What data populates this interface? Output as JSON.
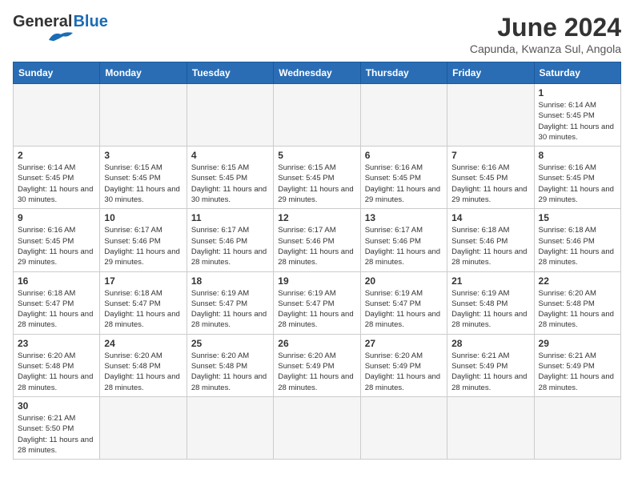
{
  "header": {
    "logo_general": "General",
    "logo_blue": "Blue",
    "title": "June 2024",
    "subtitle": "Capunda, Kwanza Sul, Angola"
  },
  "days_of_week": [
    "Sunday",
    "Monday",
    "Tuesday",
    "Wednesday",
    "Thursday",
    "Friday",
    "Saturday"
  ],
  "weeks": [
    [
      {
        "day": "",
        "sunrise": "",
        "sunset": "",
        "daylight": "",
        "empty": true
      },
      {
        "day": "",
        "sunrise": "",
        "sunset": "",
        "daylight": "",
        "empty": true
      },
      {
        "day": "",
        "sunrise": "",
        "sunset": "",
        "daylight": "",
        "empty": true
      },
      {
        "day": "",
        "sunrise": "",
        "sunset": "",
        "daylight": "",
        "empty": true
      },
      {
        "day": "",
        "sunrise": "",
        "sunset": "",
        "daylight": "",
        "empty": true
      },
      {
        "day": "",
        "sunrise": "",
        "sunset": "",
        "daylight": "",
        "empty": true
      },
      {
        "day": "1",
        "sunrise": "Sunrise: 6:14 AM",
        "sunset": "Sunset: 5:45 PM",
        "daylight": "Daylight: 11 hours and 30 minutes.",
        "empty": false
      }
    ],
    [
      {
        "day": "2",
        "sunrise": "Sunrise: 6:14 AM",
        "sunset": "Sunset: 5:45 PM",
        "daylight": "Daylight: 11 hours and 30 minutes.",
        "empty": false
      },
      {
        "day": "3",
        "sunrise": "Sunrise: 6:15 AM",
        "sunset": "Sunset: 5:45 PM",
        "daylight": "Daylight: 11 hours and 30 minutes.",
        "empty": false
      },
      {
        "day": "4",
        "sunrise": "Sunrise: 6:15 AM",
        "sunset": "Sunset: 5:45 PM",
        "daylight": "Daylight: 11 hours and 30 minutes.",
        "empty": false
      },
      {
        "day": "5",
        "sunrise": "Sunrise: 6:15 AM",
        "sunset": "Sunset: 5:45 PM",
        "daylight": "Daylight: 11 hours and 29 minutes.",
        "empty": false
      },
      {
        "day": "6",
        "sunrise": "Sunrise: 6:16 AM",
        "sunset": "Sunset: 5:45 PM",
        "daylight": "Daylight: 11 hours and 29 minutes.",
        "empty": false
      },
      {
        "day": "7",
        "sunrise": "Sunrise: 6:16 AM",
        "sunset": "Sunset: 5:45 PM",
        "daylight": "Daylight: 11 hours and 29 minutes.",
        "empty": false
      },
      {
        "day": "8",
        "sunrise": "Sunrise: 6:16 AM",
        "sunset": "Sunset: 5:45 PM",
        "daylight": "Daylight: 11 hours and 29 minutes.",
        "empty": false
      }
    ],
    [
      {
        "day": "9",
        "sunrise": "Sunrise: 6:16 AM",
        "sunset": "Sunset: 5:45 PM",
        "daylight": "Daylight: 11 hours and 29 minutes.",
        "empty": false
      },
      {
        "day": "10",
        "sunrise": "Sunrise: 6:17 AM",
        "sunset": "Sunset: 5:46 PM",
        "daylight": "Daylight: 11 hours and 29 minutes.",
        "empty": false
      },
      {
        "day": "11",
        "sunrise": "Sunrise: 6:17 AM",
        "sunset": "Sunset: 5:46 PM",
        "daylight": "Daylight: 11 hours and 28 minutes.",
        "empty": false
      },
      {
        "day": "12",
        "sunrise": "Sunrise: 6:17 AM",
        "sunset": "Sunset: 5:46 PM",
        "daylight": "Daylight: 11 hours and 28 minutes.",
        "empty": false
      },
      {
        "day": "13",
        "sunrise": "Sunrise: 6:17 AM",
        "sunset": "Sunset: 5:46 PM",
        "daylight": "Daylight: 11 hours and 28 minutes.",
        "empty": false
      },
      {
        "day": "14",
        "sunrise": "Sunrise: 6:18 AM",
        "sunset": "Sunset: 5:46 PM",
        "daylight": "Daylight: 11 hours and 28 minutes.",
        "empty": false
      },
      {
        "day": "15",
        "sunrise": "Sunrise: 6:18 AM",
        "sunset": "Sunset: 5:46 PM",
        "daylight": "Daylight: 11 hours and 28 minutes.",
        "empty": false
      }
    ],
    [
      {
        "day": "16",
        "sunrise": "Sunrise: 6:18 AM",
        "sunset": "Sunset: 5:47 PM",
        "daylight": "Daylight: 11 hours and 28 minutes.",
        "empty": false
      },
      {
        "day": "17",
        "sunrise": "Sunrise: 6:18 AM",
        "sunset": "Sunset: 5:47 PM",
        "daylight": "Daylight: 11 hours and 28 minutes.",
        "empty": false
      },
      {
        "day": "18",
        "sunrise": "Sunrise: 6:19 AM",
        "sunset": "Sunset: 5:47 PM",
        "daylight": "Daylight: 11 hours and 28 minutes.",
        "empty": false
      },
      {
        "day": "19",
        "sunrise": "Sunrise: 6:19 AM",
        "sunset": "Sunset: 5:47 PM",
        "daylight": "Daylight: 11 hours and 28 minutes.",
        "empty": false
      },
      {
        "day": "20",
        "sunrise": "Sunrise: 6:19 AM",
        "sunset": "Sunset: 5:47 PM",
        "daylight": "Daylight: 11 hours and 28 minutes.",
        "empty": false
      },
      {
        "day": "21",
        "sunrise": "Sunrise: 6:19 AM",
        "sunset": "Sunset: 5:48 PM",
        "daylight": "Daylight: 11 hours and 28 minutes.",
        "empty": false
      },
      {
        "day": "22",
        "sunrise": "Sunrise: 6:20 AM",
        "sunset": "Sunset: 5:48 PM",
        "daylight": "Daylight: 11 hours and 28 minutes.",
        "empty": false
      }
    ],
    [
      {
        "day": "23",
        "sunrise": "Sunrise: 6:20 AM",
        "sunset": "Sunset: 5:48 PM",
        "daylight": "Daylight: 11 hours and 28 minutes.",
        "empty": false
      },
      {
        "day": "24",
        "sunrise": "Sunrise: 6:20 AM",
        "sunset": "Sunset: 5:48 PM",
        "daylight": "Daylight: 11 hours and 28 minutes.",
        "empty": false
      },
      {
        "day": "25",
        "sunrise": "Sunrise: 6:20 AM",
        "sunset": "Sunset: 5:48 PM",
        "daylight": "Daylight: 11 hours and 28 minutes.",
        "empty": false
      },
      {
        "day": "26",
        "sunrise": "Sunrise: 6:20 AM",
        "sunset": "Sunset: 5:49 PM",
        "daylight": "Daylight: 11 hours and 28 minutes.",
        "empty": false
      },
      {
        "day": "27",
        "sunrise": "Sunrise: 6:20 AM",
        "sunset": "Sunset: 5:49 PM",
        "daylight": "Daylight: 11 hours and 28 minutes.",
        "empty": false
      },
      {
        "day": "28",
        "sunrise": "Sunrise: 6:21 AM",
        "sunset": "Sunset: 5:49 PM",
        "daylight": "Daylight: 11 hours and 28 minutes.",
        "empty": false
      },
      {
        "day": "29",
        "sunrise": "Sunrise: 6:21 AM",
        "sunset": "Sunset: 5:49 PM",
        "daylight": "Daylight: 11 hours and 28 minutes.",
        "empty": false
      }
    ],
    [
      {
        "day": "30",
        "sunrise": "Sunrise: 6:21 AM",
        "sunset": "Sunset: 5:50 PM",
        "daylight": "Daylight: 11 hours and 28 minutes.",
        "empty": false
      },
      {
        "day": "",
        "sunrise": "",
        "sunset": "",
        "daylight": "",
        "empty": true
      },
      {
        "day": "",
        "sunrise": "",
        "sunset": "",
        "daylight": "",
        "empty": true
      },
      {
        "day": "",
        "sunrise": "",
        "sunset": "",
        "daylight": "",
        "empty": true
      },
      {
        "day": "",
        "sunrise": "",
        "sunset": "",
        "daylight": "",
        "empty": true
      },
      {
        "day": "",
        "sunrise": "",
        "sunset": "",
        "daylight": "",
        "empty": true
      },
      {
        "day": "",
        "sunrise": "",
        "sunset": "",
        "daylight": "",
        "empty": true
      }
    ]
  ]
}
